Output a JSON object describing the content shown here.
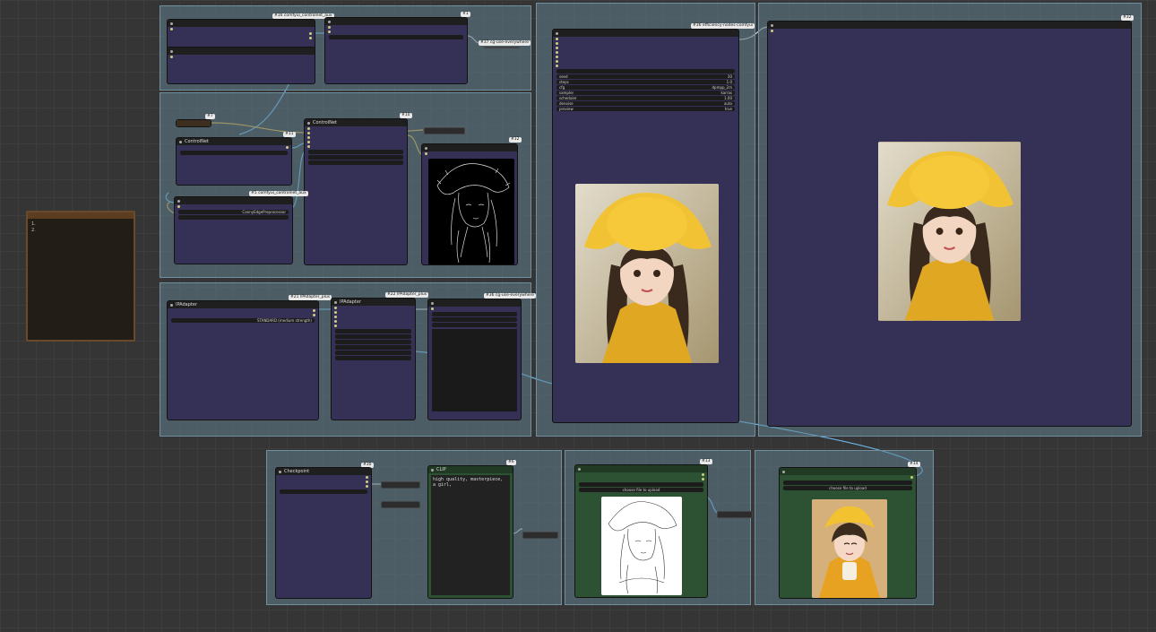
{
  "canvas": {
    "background": "#353535",
    "group_color": "#5f7d8c",
    "node_color": "#343056",
    "green_node_color": "#2d5233"
  },
  "groups": {
    "g1": "",
    "g2": "",
    "g3": "",
    "g4": "",
    "g5": "",
    "g6": "",
    "g7": "",
    "g8": "",
    "g9": ""
  },
  "note": {
    "title": "",
    "lines": [
      "",
      "1. ",
      "2. "
    ]
  },
  "nodes": {
    "load_image_top": {
      "title": "",
      "tag": "#16 comfyui_controlnet_aux"
    },
    "pipe_top": {
      "title": "",
      "tag": "#1"
    },
    "get_node_1": {
      "tag": "#37 cg-use-everywhere",
      "label": ""
    },
    "clip_text_small": {
      "title": "",
      "tag": "#7"
    },
    "controlnet_loader": {
      "title": "ControlNet",
      "tag": "#11"
    },
    "controlnet_apply": {
      "title": "ControlNet",
      "tag": "#10"
    },
    "image_preview_edge": {
      "title": "",
      "tag": "#12"
    },
    "aux_preprocessor": {
      "title": "",
      "tag": "#5 comfyui_controlnet_aux",
      "value": "CannyEdgePreprocessor"
    },
    "ipadapter_loader": {
      "title": "IPAdapter",
      "tag": "#21 IPAdapter_plus",
      "value": "STANDARD (medium strength)"
    },
    "ipadapter_apply": {
      "title": "IPAdapter",
      "tag": "#22 IPAdapter_plus"
    },
    "anything_everywhere": {
      "title": "",
      "tag": "#36 cg-use-everywhere"
    },
    "ksampler": {
      "title": "",
      "tag": "#36 efficiency-nodes-comfyui",
      "fields": [
        {
          "k": "seed",
          "v": "30"
        },
        {
          "k": "steps",
          "v": "1.0"
        },
        {
          "k": "cfg",
          "v": "dpmpp_2m"
        },
        {
          "k": "sampler",
          "v": "karras"
        },
        {
          "k": "scheduler",
          "v": "1.00"
        },
        {
          "k": "denoise",
          "v": "auto"
        },
        {
          "k": "preview",
          "v": "true"
        }
      ]
    },
    "save_image": {
      "title": "",
      "tag": "#32"
    },
    "checkpoint_loader": {
      "title": "Checkpoint",
      "tag": "#30"
    },
    "clip_text_big": {
      "title": "CLIP",
      "tag": "#6",
      "prompt": "high quality, masterpiece, a girl,"
    },
    "load_image_line": {
      "title": "",
      "tag": "#13",
      "file": "",
      "button": "choose file to upload"
    },
    "load_image_ref": {
      "title": "",
      "tag": "#14",
      "file": "",
      "button": "choose file to upload"
    }
  }
}
